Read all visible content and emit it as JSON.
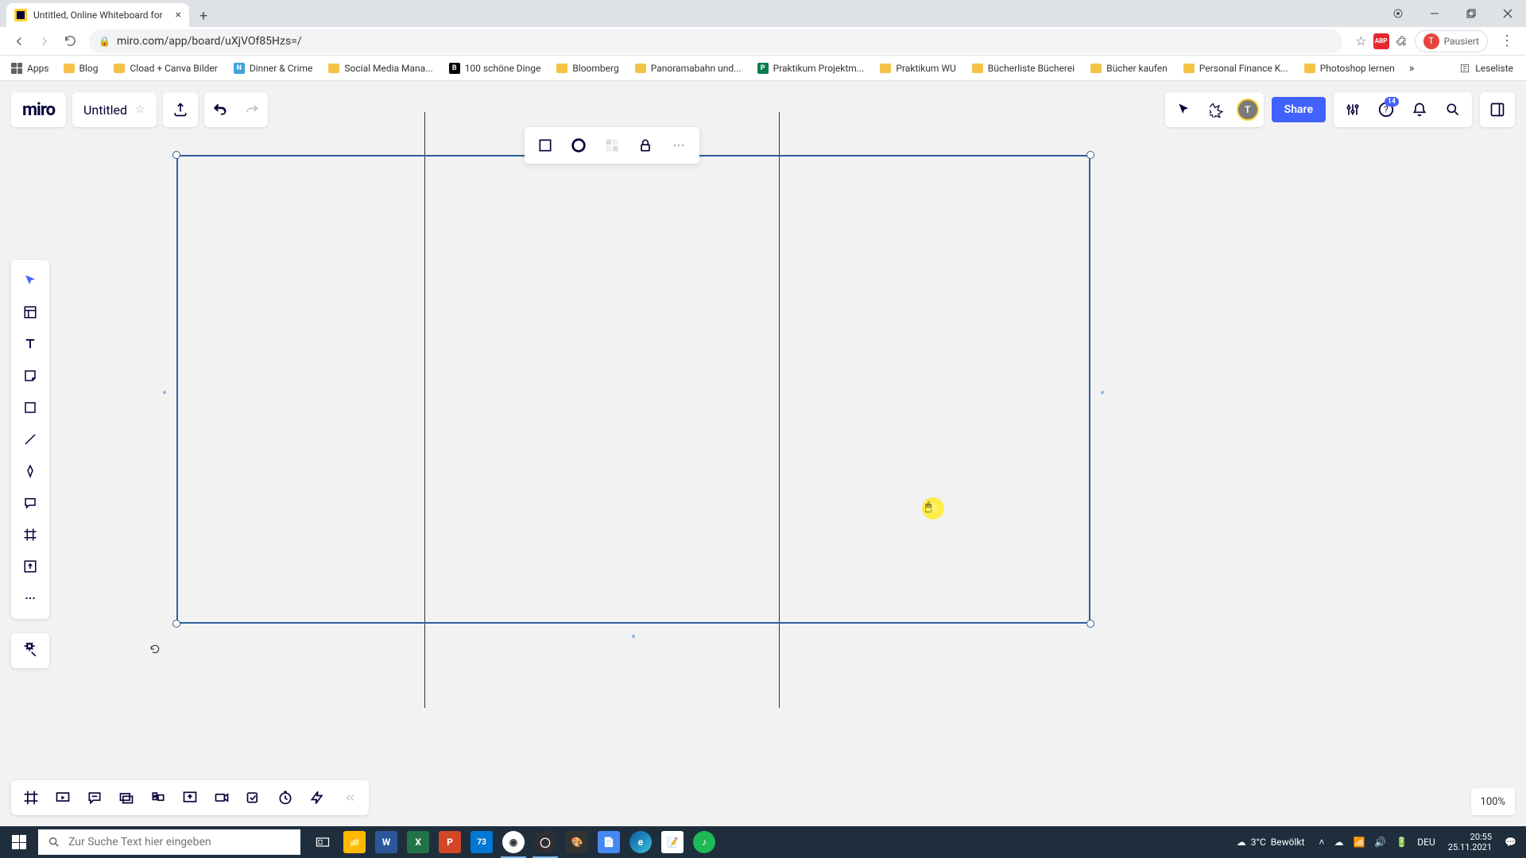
{
  "browser": {
    "tab_title": "Untitled, Online Whiteboard for",
    "url": "miro.com/app/board/uXjVOf85Hzs=/",
    "profile_label": "Pausiert"
  },
  "bookmarks": {
    "apps": "Apps",
    "items": [
      "Blog",
      "Cload + Canva Bilder",
      "Dinner & Crime",
      "Social Media Mana...",
      "100 schöne Dinge",
      "Bloomberg",
      "Panoramabahn und...",
      "Praktikum Projektm...",
      "Praktikum WU",
      "Bücherliste Bücherei",
      "Bücher kaufen",
      "Personal Finance K...",
      "Photoshop lernen"
    ],
    "reading_list": "Leseliste"
  },
  "miro": {
    "logo": "miro",
    "board_title": "Untitled",
    "share": "Share",
    "notif_count": "14",
    "avatar_initial": "T",
    "zoom": "100%"
  },
  "taskbar": {
    "search_placeholder": "Zur Suche Text hier eingeben",
    "weather_temp": "3°C",
    "weather_desc": "Bewölkt",
    "lang": "DEU",
    "time": "20:55",
    "date": "25.11.2021",
    "calendar_badge": "73"
  }
}
